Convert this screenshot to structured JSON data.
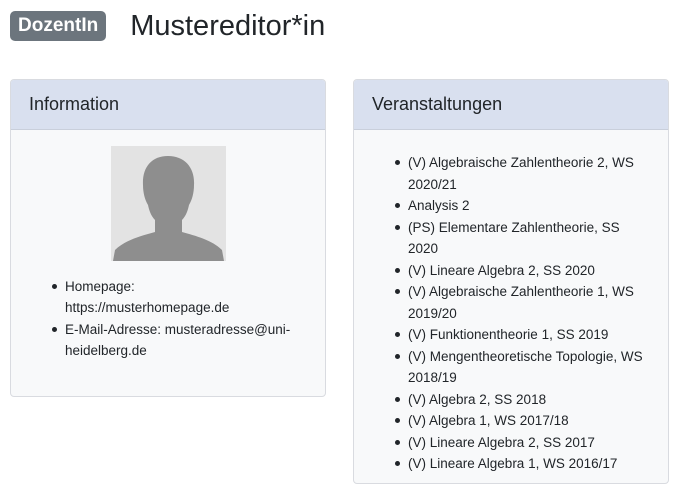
{
  "header": {
    "badge": "DozentIn",
    "name": "Mustereditor*in"
  },
  "info_card": {
    "title": "Information",
    "avatar_icon": "person-silhouette-icon",
    "homepage_label": "Homepage:",
    "homepage_value": "https://musterhomepage.de",
    "email_label": "E-Mail-Adresse:",
    "email_value": "musteradresse@uni-heidelberg.de"
  },
  "courses_card": {
    "title": "Veranstaltungen",
    "items": [
      "(V) Algebraische Zahlentheorie 2, WS 2020/21",
      "Analysis 2",
      "(PS) Elementare Zahlentheorie, SS 2020",
      "(V) Lineare Algebra 2, SS 2020",
      "(V) Algebraische Zahlentheorie 1, WS 2019/20",
      "(V) Funktionentheorie 1, SS 2019",
      "(V) Mengentheoretische Topologie, WS 2018/19",
      "(V) Algebra 2, SS 2018",
      "(V) Algebra 1, WS 2017/18",
      "(V) Lineare Algebra 2, SS 2017",
      "(V) Lineare Algebra 1, WS 2016/17"
    ]
  },
  "colors": {
    "badge_bg": "#6c757d",
    "card_header_bg": "#d9e0ef",
    "card_bg": "#f8f9fa"
  }
}
